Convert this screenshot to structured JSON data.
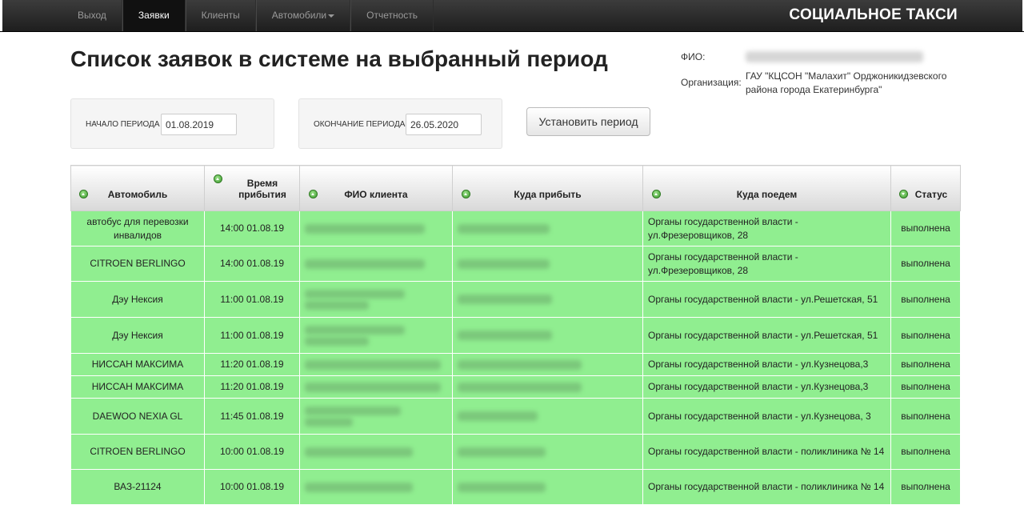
{
  "nav": {
    "items": [
      {
        "label": "Выход",
        "active": false
      },
      {
        "label": "Заявки",
        "active": true
      },
      {
        "label": "Клиенты",
        "active": false
      },
      {
        "label": "Автомобили",
        "active": false,
        "dropdown": true
      },
      {
        "label": "Отчетность",
        "active": false
      }
    ],
    "brand": "СОЦИАЛЬНОЕ ТАКСИ"
  },
  "page": {
    "title": "Список заявок в системе на выбранный период"
  },
  "user": {
    "fio_label": "ФИО:",
    "org_label": "Организация:",
    "org_value": "ГАУ \"КЦСОН \"Малахит\" Орджоникидзевского района города Екатеринбурга\""
  },
  "period": {
    "start_label": "НАЧАЛО ПЕРИОДА",
    "start_value": "01.08.2019",
    "end_label": "ОКОНЧАНИЕ ПЕРИОДА",
    "end_value": "26.05.2020",
    "button_label": "Установить период"
  },
  "table": {
    "headers": {
      "car": "Автомобиль",
      "time": "Время прибытия",
      "client": "ФИО клиента",
      "from": "Куда прибыть",
      "to": "Куда поедем",
      "status": "Статус"
    },
    "row_color": "#90ee90",
    "rows": [
      {
        "car": "автобус для перевозки инвалидов",
        "time": "14:00 01.08.19",
        "to": "Органы государственной власти - ул.Фрезеровщиков, 28",
        "status": "выполнена"
      },
      {
        "car": "CITROEN BERLINGO",
        "time": "14:00 01.08.19",
        "to": "Органы государственной власти - ул.Фрезеровщиков, 28",
        "status": "выполнена"
      },
      {
        "car": "Дэу Нексия",
        "time": "11:00 01.08.19",
        "to": "Органы государственной власти - ул.Решетская, 51",
        "status": "выполнена"
      },
      {
        "car": "Дэу Нексия",
        "time": "11:00 01.08.19",
        "to": "Органы государственной власти - ул.Решетская, 51",
        "status": "выполнена"
      },
      {
        "car": "НИССАН МАКСИМА",
        "time": "11:20 01.08.19",
        "to": "Органы государственной власти - ул.Кузнецова,3",
        "status": "выполнена"
      },
      {
        "car": "НИССАН МАКСИМА",
        "time": "11:20 01.08.19",
        "to": "Органы государственной власти - ул.Кузнецова,3",
        "status": "выполнена"
      },
      {
        "car": "DAEWOO NEXIA GL",
        "time": "11:45 01.08.19",
        "to": "Органы государственной власти - ул.Кузнецова, 3",
        "status": "выполнена"
      },
      {
        "car": "CITROEN BERLINGO",
        "time": "10:00 01.08.19",
        "to": "Органы государственной власти - поликлиника № 14",
        "status": "выполнена"
      },
      {
        "car": "ВАЗ-21124",
        "time": "10:00 01.08.19",
        "to": "Органы государственной власти - поликлиника № 14",
        "status": "выполнена"
      }
    ]
  }
}
